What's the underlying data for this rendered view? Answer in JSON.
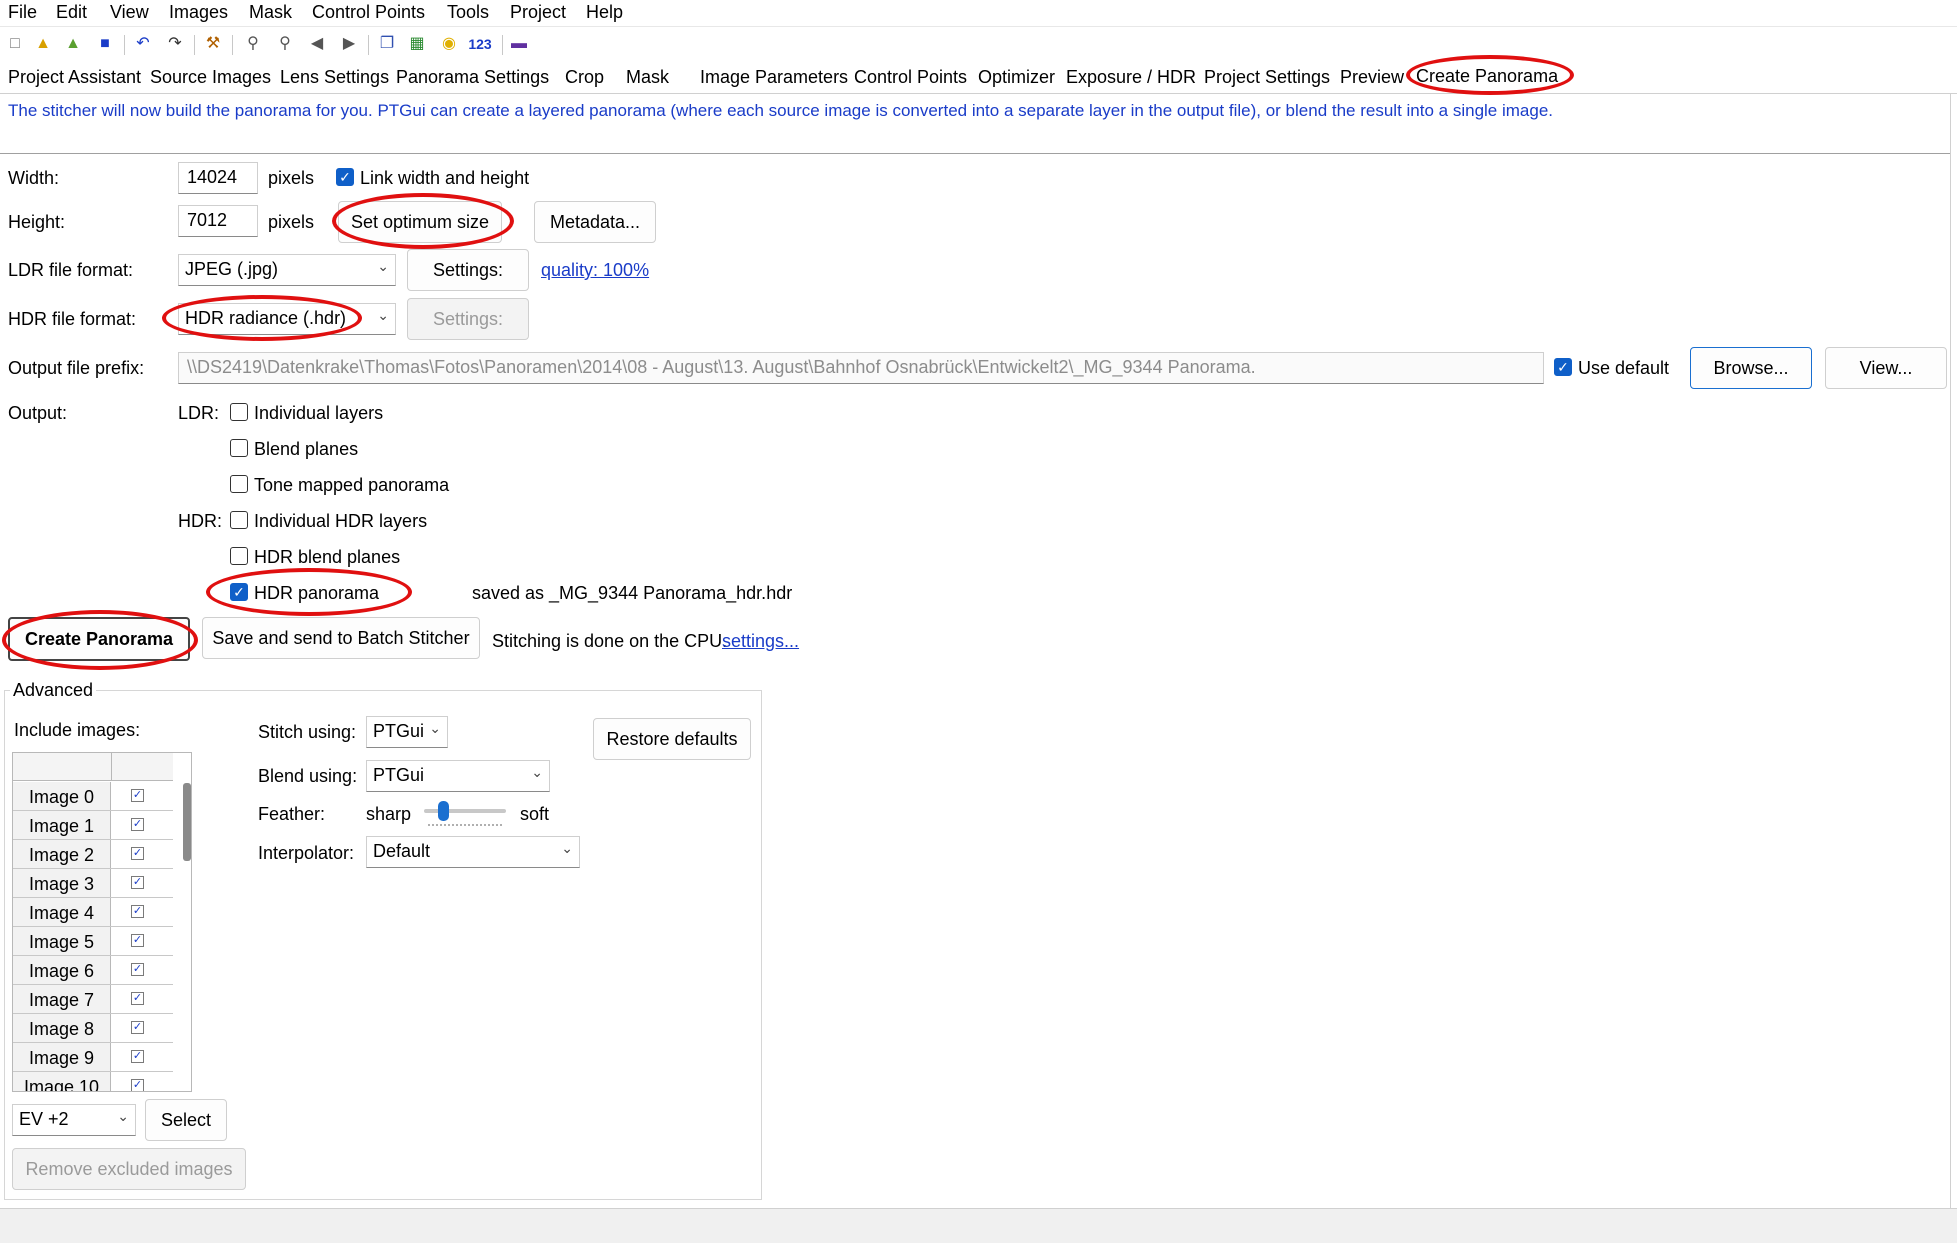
{
  "menu": [
    "File",
    "Edit",
    "View",
    "Images",
    "Mask",
    "Control Points",
    "Tools",
    "Project",
    "Help"
  ],
  "toolbar_icons": [
    "new-icon",
    "open-icon",
    "open-recent-icon",
    "save-icon",
    "undo-icon",
    "redo-icon",
    "tools-icon",
    "zoom-in-icon",
    "zoom-out-icon",
    "prev-icon",
    "next-icon",
    "copy-icon",
    "table-icon",
    "numbers-icon",
    "lightbulb-icon",
    "book-icon"
  ],
  "toolbar_numbers_label": "123",
  "tabs": [
    "Project Assistant",
    "Source Images",
    "Lens Settings",
    "Panorama Settings",
    "Crop",
    "Mask",
    "Image Parameters",
    "Control Points",
    "Optimizer",
    "Exposure / HDR",
    "Project Settings",
    "Preview",
    "Create Panorama"
  ],
  "active_tab": "Create Panorama",
  "intro": "The stitcher will now build the panorama for you. PTGui can create a layered panorama (where each source image is converted into a separate layer in the output file), or blend the result into a single image.",
  "size": {
    "width_label": "Width:",
    "width_value": "14024",
    "height_label": "Height:",
    "height_value": "7012",
    "unit": "pixels",
    "link_label": "Link width and height",
    "link_checked": true,
    "optimum_button": "Set optimum size",
    "metadata_button": "Metadata..."
  },
  "ldr": {
    "label": "LDR file format:",
    "value": "JPEG (.jpg)",
    "settings_button": "Settings:",
    "quality_link": "quality: 100%"
  },
  "hdr": {
    "label": "HDR file format:",
    "value": "HDR radiance (.hdr)",
    "settings_button": "Settings:"
  },
  "output_prefix": {
    "label": "Output file prefix:",
    "value": "\\\\DS2419\\Datenkrake\\Thomas\\Fotos\\Panoramen\\2014\\08 - August\\13. August\\Bahnhof Osnabrück\\Entwickelt2\\_MG_9344 Panorama.",
    "use_default_label": "Use default",
    "use_default_checked": true,
    "browse_button": "Browse...",
    "view_button": "View..."
  },
  "output": {
    "label": "Output:",
    "ldr_label": "LDR:",
    "hdr_label": "HDR:",
    "ldr_options": [
      {
        "label": "Individual layers",
        "checked": false
      },
      {
        "label": "Blend planes",
        "checked": false
      },
      {
        "label": "Tone mapped panorama",
        "checked": false
      }
    ],
    "hdr_options": [
      {
        "label": "Individual HDR layers",
        "checked": false
      },
      {
        "label": "HDR blend planes",
        "checked": false
      },
      {
        "label": "HDR panorama",
        "checked": true
      }
    ],
    "saved_as": "saved as _MG_9344 Panorama_hdr.hdr"
  },
  "actions": {
    "create_button": "Create Panorama",
    "batch_button": "Save and send to Batch Stitcher",
    "cpu_text": "Stitching is done on the CPU.",
    "settings_link": "settings..."
  },
  "advanced": {
    "title": "Advanced",
    "include_label": "Include images:",
    "images": [
      "Image 0",
      "Image 1",
      "Image 2",
      "Image 3",
      "Image 4",
      "Image 5",
      "Image 6",
      "Image 7",
      "Image 8",
      "Image 9",
      "Image 10"
    ],
    "ev_value": "EV +2",
    "select_button": "Select",
    "remove_button": "Remove excluded images",
    "stitch_label": "Stitch using:",
    "stitch_value": "PTGui",
    "blend_label": "Blend using:",
    "blend_value": "PTGui",
    "feather_label": "Feather:",
    "feather_sharp": "sharp",
    "feather_soft": "soft",
    "feather_level": 0.2,
    "interpolator_label": "Interpolator:",
    "interpolator_value": "Default",
    "restore_button": "Restore defaults"
  },
  "colors": {
    "accent": "#1a6fd0",
    "link": "#1a3cc8",
    "highlight_ring": "#e01010"
  }
}
